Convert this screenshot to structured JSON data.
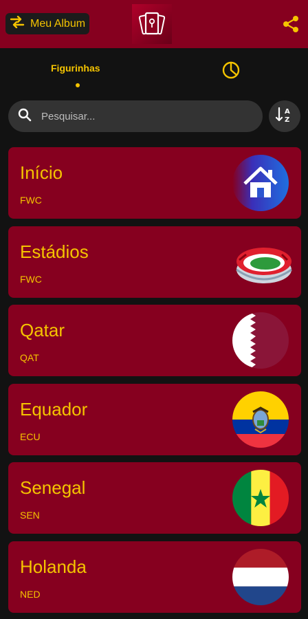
{
  "header": {
    "album_label": "Meu Album",
    "swap_icon": "swap-arrows-icon",
    "logo_icon": "sticker-album-logo",
    "share_icon": "share-icon"
  },
  "tabs": {
    "stickers_label": "Figurinhas",
    "history_icon": "pie-chart-icon"
  },
  "search": {
    "placeholder": "Pesquisar...",
    "sort_icon": "sort-az-icon"
  },
  "colors": {
    "accent": "#f5c400",
    "brand": "#86001f",
    "background": "#121212",
    "surface": "#333333"
  },
  "sections": [
    {
      "name": "Início",
      "code": "FWC",
      "icon": "home-icon"
    },
    {
      "name": "Estádios",
      "code": "FWC",
      "icon": "stadium-icon"
    },
    {
      "name": "Qatar",
      "code": "QAT",
      "icon": "qatar-flag"
    },
    {
      "name": "Equador",
      "code": "ECU",
      "icon": "ecuador-flag"
    },
    {
      "name": "Senegal",
      "code": "SEN",
      "icon": "senegal-flag"
    },
    {
      "name": "Holanda",
      "code": "NED",
      "icon": "netherlands-flag"
    }
  ]
}
